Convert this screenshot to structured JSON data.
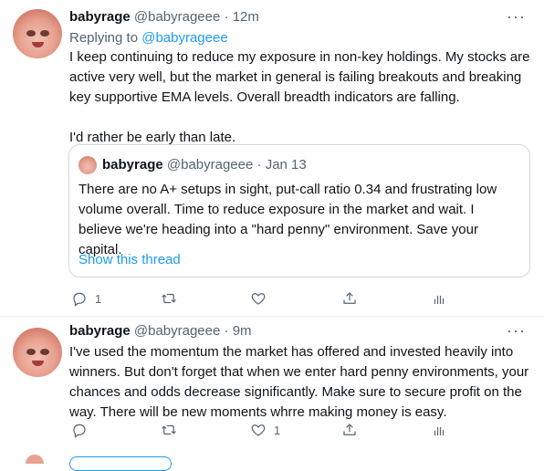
{
  "tweet1": {
    "name": "babyrage",
    "handle": "@babyrageee",
    "separator": "·",
    "time": "12m",
    "more": "···",
    "replying_label": "Replying to",
    "replying_handle": "@babyrageee",
    "text": "I keep continuing to reduce my exposure in non-key holdings. My stocks are active very well, but the market in general is failing breakouts and breaking key supportive EMA levels. Overall breadth indicators are falling.\n\nI'd rather be early than late.",
    "quote": {
      "name": "babyrage",
      "handle": "@babyrageee",
      "separator": "·",
      "date": "Jan 13",
      "text": "There are no A+ setups in sight, put-call ratio 0.34 and frustrating low volume overall. Time to reduce exposure in the market and wait. I believe we're heading into a \"hard penny\" environment. Save your capital.",
      "show_thread": "Show this thread"
    },
    "actions": {
      "reply_count": "1",
      "retweet_count": "",
      "like_count": ""
    }
  },
  "tweet2": {
    "name": "babyrage",
    "handle": "@babyrageee",
    "separator": "·",
    "time": "9m",
    "more": "···",
    "text": "I've used the momentum the market has offered and invested heavily into winners. But don't forget that when we enter hard penny environments, your chances and odds decrease significantly. Make sure to secure profit on the way. There will be new moments whrre making money is easy.",
    "actions": {
      "reply_count": "",
      "retweet_count": "",
      "like_count": "1"
    }
  },
  "icons": {
    "reply": "reply-icon",
    "retweet": "retweet-icon",
    "like": "heart-icon",
    "share": "share-icon",
    "analytics": "analytics-icon"
  },
  "colors": {
    "link": "#1d9bf0",
    "muted": "#536471",
    "text": "#0f1419",
    "border": "#cfd9de"
  }
}
